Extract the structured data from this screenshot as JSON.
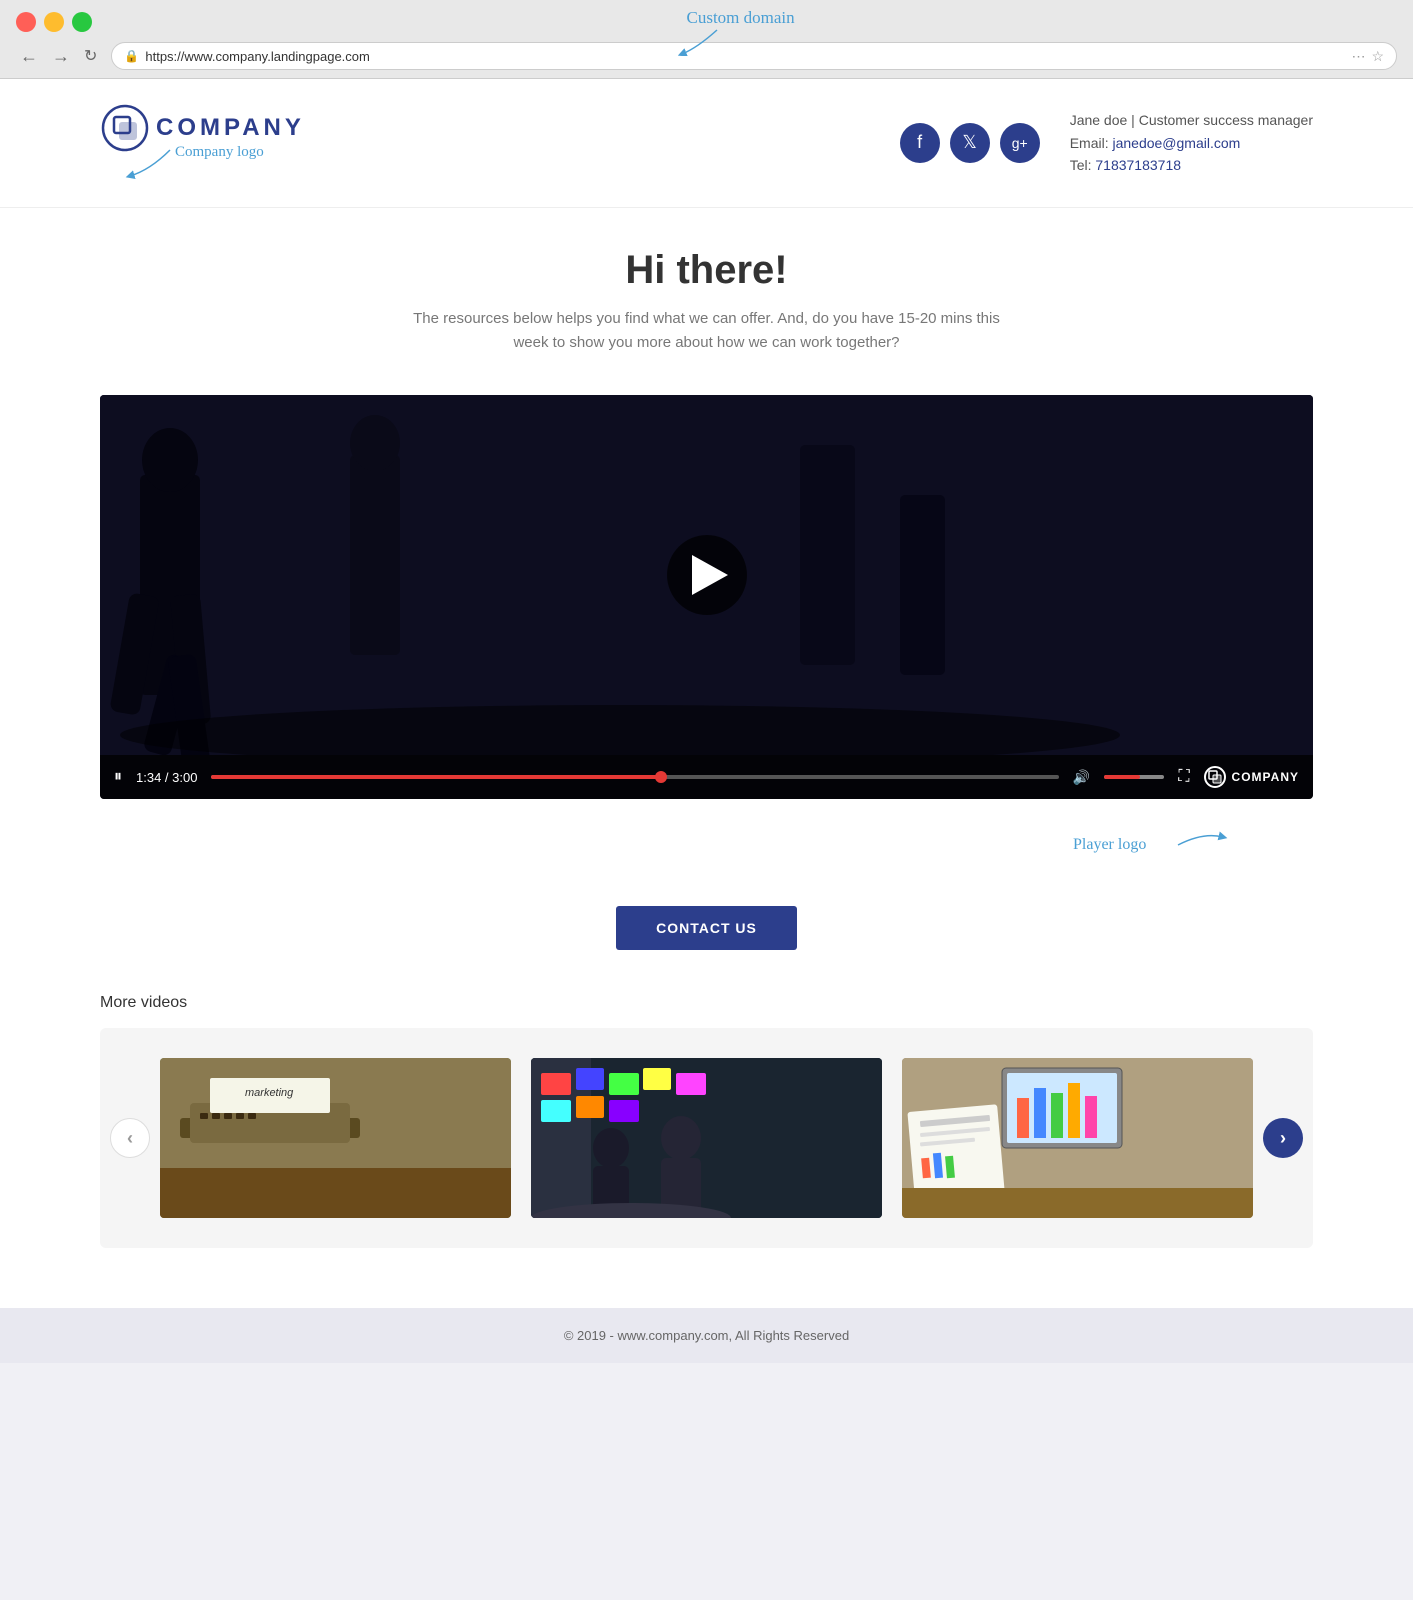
{
  "browser": {
    "url": "https://www.company.landingpage.com",
    "custom_domain_annotation": "Custom domain"
  },
  "annotations": {
    "company_logo": "Company logo",
    "player_logo": "Player logo"
  },
  "header": {
    "company_name": "COMPANY",
    "contact_name": "Jane doe | Customer success manager",
    "email_label": "Email:",
    "email_value": "janedoe@gmail.com",
    "tel_label": "Tel:",
    "tel_value": "71837183718",
    "social_icons": [
      "f",
      "t",
      "g+"
    ]
  },
  "hero": {
    "title": "Hi there!",
    "subtitle": "The resources below helps you find what we can offer. And, do you have 15-20 mins this week to show you more about how we can work together?"
  },
  "video": {
    "time_current": "1:34",
    "time_total": "3:00",
    "time_display": "1:34 / 3:00",
    "progress_percent": 53
  },
  "contact_button": {
    "label": "CONTACT US"
  },
  "more_videos": {
    "section_title": "More videos"
  },
  "footer": {
    "text": "© 2019 - www.company.com, All Rights Reserved"
  },
  "nav": {
    "back": "←",
    "forward": "→",
    "refresh": "↻"
  }
}
